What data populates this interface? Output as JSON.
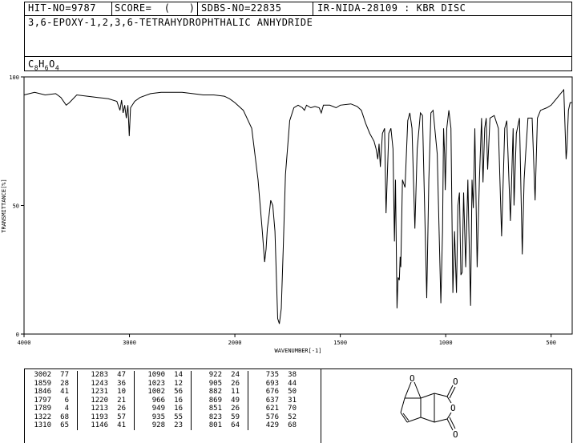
{
  "header": {
    "hit_no": "HIT-NO=9787",
    "score": "SCORE=  (   )",
    "sdbs_no": "SDBS-NO=22835",
    "ir_info": "IR-NIDA-28109 : KBR DISC",
    "compound_name": "3,6-EPOXY-1,2,3,6-TETRAHYDROPHTHALIC ANHYDRIDE",
    "formula_base": "C",
    "formula_c": "8",
    "formula_h_label": "H",
    "formula_h": "6",
    "formula_o_label": "O",
    "formula_o": "4"
  },
  "chart_data": {
    "type": "line",
    "title": "",
    "xlabel": "WAVENUMBER[-1]",
    "ylabel": "TRANSMITTANCE[%]",
    "xlim": [
      4000,
      400
    ],
    "ylim": [
      0,
      100
    ],
    "x_ticks": [
      "4000",
      "3000",
      "2000",
      "1500",
      "1000",
      "500"
    ],
    "y_ticks": [
      "100",
      "50",
      "0"
    ],
    "series": [
      {
        "name": "",
        "points": [
          [
            4000,
            93
          ],
          [
            3900,
            94
          ],
          [
            3800,
            93
          ],
          [
            3700,
            93.5
          ],
          [
            3650,
            92
          ],
          [
            3600,
            89
          ],
          [
            3570,
            90
          ],
          [
            3500,
            93
          ],
          [
            3400,
            92.5
          ],
          [
            3300,
            92
          ],
          [
            3200,
            91.5
          ],
          [
            3120,
            90.5
          ],
          [
            3090,
            87
          ],
          [
            3075,
            91
          ],
          [
            3060,
            86
          ],
          [
            3045,
            89
          ],
          [
            3030,
            84
          ],
          [
            3015,
            89
          ],
          [
            3002,
            77
          ],
          [
            2990,
            88
          ],
          [
            2950,
            90.5
          ],
          [
            2900,
            92
          ],
          [
            2800,
            93.5
          ],
          [
            2700,
            94
          ],
          [
            2600,
            94
          ],
          [
            2500,
            94
          ],
          [
            2400,
            93.5
          ],
          [
            2300,
            93
          ],
          [
            2200,
            93
          ],
          [
            2100,
            92.5
          ],
          [
            2050,
            91.5
          ],
          [
            2000,
            90
          ],
          [
            1960,
            87
          ],
          [
            1920,
            80
          ],
          [
            1890,
            60
          ],
          [
            1870,
            40
          ],
          [
            1859,
            28
          ],
          [
            1852,
            33
          ],
          [
            1846,
            41
          ],
          [
            1838,
            46
          ],
          [
            1830,
            52
          ],
          [
            1820,
            50
          ],
          [
            1810,
            40
          ],
          [
            1797,
            6
          ],
          [
            1789,
            4
          ],
          [
            1780,
            10
          ],
          [
            1770,
            35
          ],
          [
            1760,
            62
          ],
          [
            1740,
            83
          ],
          [
            1720,
            88
          ],
          [
            1700,
            89
          ],
          [
            1680,
            88
          ],
          [
            1670,
            87
          ],
          [
            1660,
            89
          ],
          [
            1640,
            88
          ],
          [
            1620,
            88.5
          ],
          [
            1600,
            88
          ],
          [
            1590,
            86
          ],
          [
            1580,
            89
          ],
          [
            1550,
            89
          ],
          [
            1520,
            88
          ],
          [
            1500,
            89
          ],
          [
            1450,
            89.5
          ],
          [
            1420,
            88.5
          ],
          [
            1400,
            87
          ],
          [
            1380,
            82
          ],
          [
            1360,
            78
          ],
          [
            1340,
            75
          ],
          [
            1330,
            72
          ],
          [
            1322,
            68
          ],
          [
            1316,
            74
          ],
          [
            1310,
            65
          ],
          [
            1300,
            78
          ],
          [
            1290,
            80
          ],
          [
            1283,
            47
          ],
          [
            1270,
            78
          ],
          [
            1260,
            80
          ],
          [
            1250,
            72
          ],
          [
            1243,
            36
          ],
          [
            1238,
            60
          ],
          [
            1231,
            10
          ],
          [
            1226,
            22
          ],
          [
            1220,
            21
          ],
          [
            1216,
            30
          ],
          [
            1213,
            26
          ],
          [
            1205,
            60
          ],
          [
            1193,
            57
          ],
          [
            1180,
            83
          ],
          [
            1170,
            86
          ],
          [
            1160,
            80
          ],
          [
            1146,
            41
          ],
          [
            1135,
            72
          ],
          [
            1120,
            86
          ],
          [
            1110,
            85
          ],
          [
            1090,
            14
          ],
          [
            1080,
            60
          ],
          [
            1070,
            86
          ],
          [
            1060,
            87
          ],
          [
            1040,
            70
          ],
          [
            1023,
            12
          ],
          [
            1015,
            40
          ],
          [
            1010,
            80
          ],
          [
            1005,
            70
          ],
          [
            1002,
            56
          ],
          [
            995,
            80
          ],
          [
            985,
            87
          ],
          [
            975,
            80
          ],
          [
            966,
            16
          ],
          [
            958,
            40
          ],
          [
            949,
            16
          ],
          [
            942,
            50
          ],
          [
            935,
            55
          ],
          [
            928,
            23
          ],
          [
            922,
            24
          ],
          [
            915,
            55
          ],
          [
            905,
            26
          ],
          [
            895,
            60
          ],
          [
            890,
            40
          ],
          [
            882,
            11
          ],
          [
            875,
            60
          ],
          [
            869,
            49
          ],
          [
            862,
            80
          ],
          [
            851,
            26
          ],
          [
            840,
            60
          ],
          [
            830,
            84
          ],
          [
            823,
            59
          ],
          [
            815,
            80
          ],
          [
            808,
            84
          ],
          [
            801,
            64
          ],
          [
            790,
            84
          ],
          [
            770,
            85
          ],
          [
            750,
            80
          ],
          [
            735,
            38
          ],
          [
            720,
            80
          ],
          [
            710,
            83
          ],
          [
            693,
            44
          ],
          [
            680,
            80
          ],
          [
            676,
            50
          ],
          [
            665,
            78
          ],
          [
            650,
            84
          ],
          [
            637,
            31
          ],
          [
            628,
            60
          ],
          [
            621,
            70
          ],
          [
            610,
            84
          ],
          [
            590,
            84
          ],
          [
            576,
            52
          ],
          [
            565,
            84
          ],
          [
            550,
            87
          ],
          [
            520,
            88
          ],
          [
            500,
            89
          ],
          [
            470,
            92
          ],
          [
            450,
            94
          ],
          [
            440,
            95
          ],
          [
            429,
            68
          ],
          [
            425,
            72
          ],
          [
            418,
            87
          ],
          [
            410,
            90
          ],
          [
            400,
            90
          ]
        ]
      }
    ],
    "peak_table": {
      "columns": [
        [
          [
            "3002",
            "77"
          ],
          [
            "1859",
            "28"
          ],
          [
            "1846",
            "41"
          ],
          [
            "1797",
            "6"
          ],
          [
            "1789",
            "4"
          ],
          [
            "1322",
            "68"
          ],
          [
            "1310",
            "65"
          ]
        ],
        [
          [
            "1283",
            "47"
          ],
          [
            "1243",
            "36"
          ],
          [
            "1231",
            "10"
          ],
          [
            "1220",
            "21"
          ],
          [
            "1213",
            "26"
          ],
          [
            "1193",
            "57"
          ],
          [
            "1146",
            "41"
          ]
        ],
        [
          [
            "1090",
            "14"
          ],
          [
            "1023",
            "12"
          ],
          [
            "1002",
            "56"
          ],
          [
            "966",
            "16"
          ],
          [
            "949",
            "16"
          ],
          [
            "935",
            "55"
          ],
          [
            "928",
            "23"
          ]
        ],
        [
          [
            "922",
            "24"
          ],
          [
            "905",
            "26"
          ],
          [
            "882",
            "11"
          ],
          [
            "869",
            "49"
          ],
          [
            "851",
            "26"
          ],
          [
            "823",
            "59"
          ],
          [
            "801",
            "64"
          ]
        ],
        [
          [
            "735",
            "38"
          ],
          [
            "693",
            "44"
          ],
          [
            "676",
            "50"
          ],
          [
            "637",
            "31"
          ],
          [
            "621",
            "70"
          ],
          [
            "576",
            "52"
          ],
          [
            "429",
            "68"
          ]
        ]
      ]
    },
    "grid": false,
    "legend": "none"
  },
  "structure": {
    "atom_labels": [
      "O",
      "O",
      "O",
      "O"
    ]
  }
}
